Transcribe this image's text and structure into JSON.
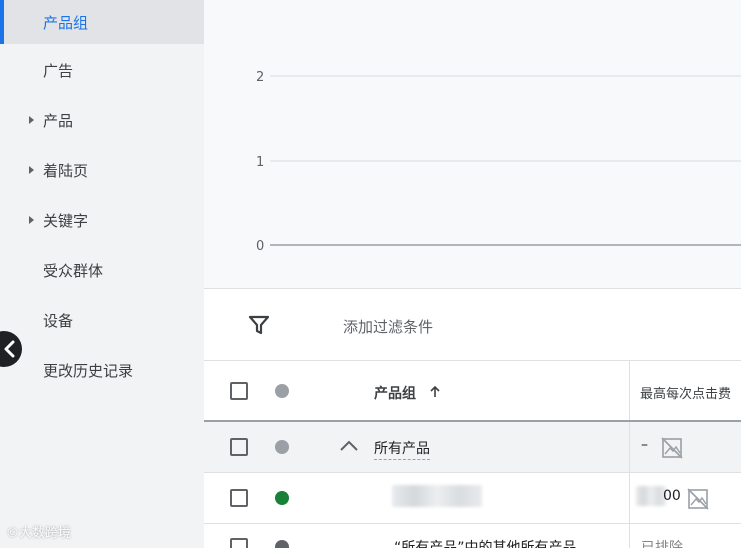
{
  "sidebar": {
    "items": [
      {
        "label": "产品组",
        "active": true,
        "expandable": false
      },
      {
        "label": "广告",
        "active": false,
        "expandable": false
      },
      {
        "label": "产品",
        "active": false,
        "expandable": true
      },
      {
        "label": "着陆页",
        "active": false,
        "expandable": true
      },
      {
        "label": "关键字",
        "active": false,
        "expandable": true
      },
      {
        "label": "受众群体",
        "active": false,
        "expandable": false
      },
      {
        "label": "设备",
        "active": false,
        "expandable": false
      },
      {
        "label": "更改历史记录",
        "active": false,
        "expandable": false
      }
    ],
    "collapse_icon": "chevron-left-icon"
  },
  "watermark": "©大数跨境",
  "chart": {
    "y_ticks": [
      "2",
      "1",
      "0"
    ]
  },
  "chart_data": {
    "type": "line",
    "title": "",
    "xlabel": "",
    "ylabel": "",
    "ylim": [
      0,
      2
    ],
    "yticks": [
      0,
      1,
      2
    ],
    "grid": true,
    "series": []
  },
  "filter": {
    "icon": "filter-icon",
    "label": "添加过滤条件"
  },
  "table": {
    "headers": {
      "product_group": "产品组",
      "sort_icon": "arrow-up-icon",
      "max_cpc": "最高每次点击费"
    },
    "rows": [
      {
        "status_color": "#9aa0a6",
        "name": "所有产品",
        "bid": "–",
        "bid_icon": "image-off-icon",
        "expand_icon": "chevron-up-icon"
      },
      {
        "status_color": "#188038",
        "name": "",
        "bid": "00",
        "bid_icon": "image-off-icon"
      },
      {
        "status_color": "#5f6368",
        "name": "“所有产品”中的其他所有产品",
        "bid": "已排除"
      }
    ]
  },
  "colors": {
    "accent": "#1a73e8",
    "status_enabled": "#188038",
    "status_neutral": "#9aa0a6"
  }
}
